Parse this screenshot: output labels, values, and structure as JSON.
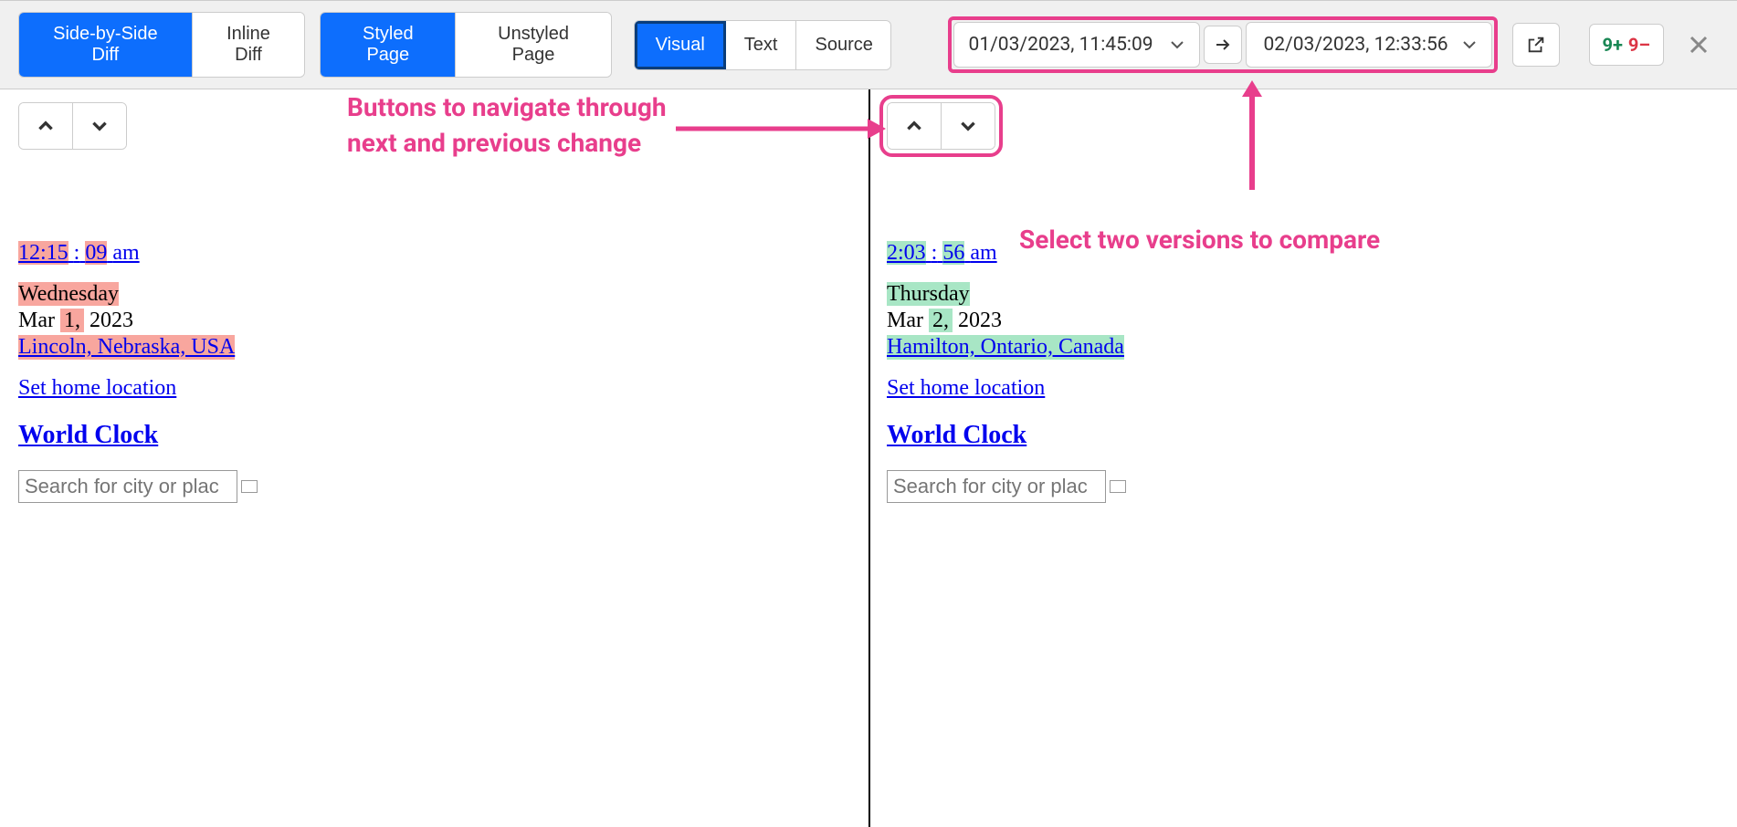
{
  "toolbar": {
    "diff_mode": {
      "side_by_side": "Side-by-Side Diff",
      "inline": "Inline Diff"
    },
    "page_mode": {
      "styled": "Styled Page",
      "unstyled": "Unstyled Page"
    },
    "view_mode": {
      "visual": "Visual",
      "text": "Text",
      "source": "Source"
    },
    "date_from": "01/03/2023, 11:45:09",
    "date_to": "02/03/2023, 12:33:56",
    "count_plus": "9+",
    "count_minus": "9–"
  },
  "annotations": {
    "nav_buttons": "Buttons to navigate through next and previous change",
    "version_select": "Select two versions to compare"
  },
  "left": {
    "time": {
      "h": "12:15",
      "sep": ":",
      "s": "09",
      "ampm": "am"
    },
    "day": "Wednesday",
    "date_month": "Mar",
    "date_day": "1,",
    "date_year": "2023",
    "location": "Lincoln, Nebraska, USA",
    "home_link": "Set home location",
    "world_clock": "World Clock",
    "search_placeholder": "Search for city or plac"
  },
  "right": {
    "time": {
      "h": "2:03",
      "sep": ":",
      "s": "56",
      "ampm": "am"
    },
    "day": "Thursday",
    "date_month": "Mar",
    "date_day": "2,",
    "date_year": "2023",
    "location": "Hamilton, Ontario, Canada",
    "home_link": "Set home location",
    "world_clock": "World Clock",
    "search_placeholder": "Search for city or plac"
  }
}
